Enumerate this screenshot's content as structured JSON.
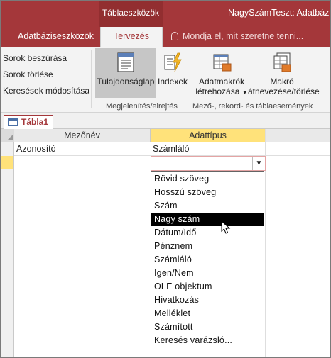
{
  "titlebar": {
    "tool_group": "Táblaeszközök",
    "app_title": "NagySzámTeszt: Adatbázis"
  },
  "tabs": {
    "database_tools": "Adatbáziseszközök",
    "design": "Tervezés",
    "tell_me_placeholder": "Mondja el, mit szeretne tenni..."
  },
  "ribbon": {
    "insert_rows": "Sorok beszúrása",
    "delete_rows": "Sorok törlése",
    "modify_lookups": "Keresések módosítása",
    "property_sheet": "Tulajdonságlap",
    "indexes": "Indexek",
    "create_data_macros_line1": "Adatmakrók",
    "create_data_macros_line2": "létrehozása",
    "rename_delete_macro_line1": "Makró",
    "rename_delete_macro_line2": "átnevezése/törlése",
    "group_show_hide": "Megjelenítés/elrejtés",
    "group_field_record_table_events": "Mező-, rekord- és táblaesemények"
  },
  "document": {
    "tab_name": "Tábla1"
  },
  "grid": {
    "col_field_name": "Mezőnév",
    "col_data_type": "Adattípus",
    "rows": [
      {
        "field_name": "Azonosító",
        "data_type": "Számláló"
      },
      {
        "field_name": "",
        "data_type": ""
      }
    ]
  },
  "dropdown": {
    "selected": "Nagy szám",
    "options": [
      "Rövid szöveg",
      "Hosszú szöveg",
      "Szám",
      "Nagy szám",
      "Dátum/Idő",
      "Pénznem",
      "Számláló",
      "Igen/Nem",
      "OLE objektum",
      "Hivatkozás",
      "Melléklet",
      "Számított",
      "Keresés varázsló..."
    ]
  },
  "colors": {
    "accent": "#a4373a",
    "highlight_header": "#ffe27a",
    "selected_option_bg": "#000000"
  }
}
